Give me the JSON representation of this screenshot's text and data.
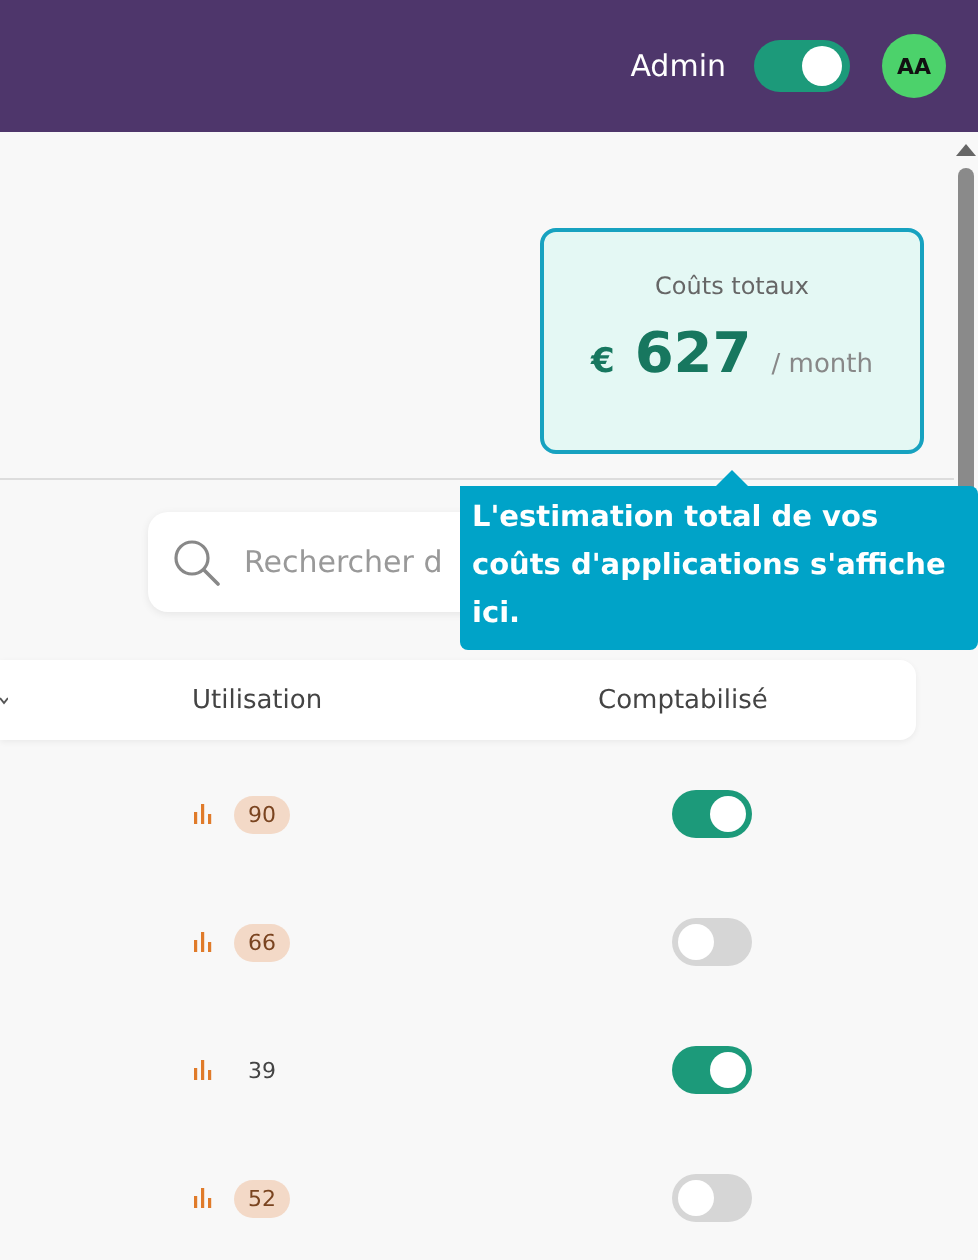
{
  "header": {
    "user_label": "Admin",
    "admin_toggle": {
      "on": true
    },
    "avatar_initials": "AA"
  },
  "cost_card": {
    "title": "Coûts totaux",
    "currency": "€",
    "amount": "627",
    "period": "/ month"
  },
  "search": {
    "placeholder": "Rechercher d"
  },
  "tooltip": {
    "text": "L'estimation total de vos coûts d'applications s'affiche ici."
  },
  "table": {
    "columns": [
      "Utilisation",
      "Comptabilisé"
    ],
    "rows": [
      {
        "usage": "90",
        "highlighted": true,
        "accounted": true
      },
      {
        "usage": "66",
        "highlighted": true,
        "accounted": false
      },
      {
        "usage": "39",
        "highlighted": false,
        "accounted": true
      },
      {
        "usage": "52",
        "highlighted": true,
        "accounted": false
      }
    ]
  }
}
